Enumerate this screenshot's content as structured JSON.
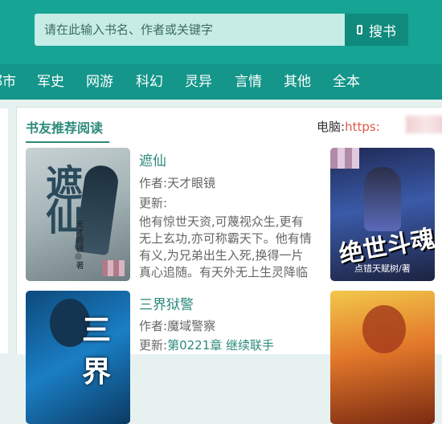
{
  "search": {
    "placeholder": "请在此输入书名、作者或关键字",
    "button_label": "搜书"
  },
  "nav": {
    "items": [
      {
        "label": "都市"
      },
      {
        "label": "军史"
      },
      {
        "label": "网游"
      },
      {
        "label": "科幻"
      },
      {
        "label": "灵异"
      },
      {
        "label": "言情"
      },
      {
        "label": "其他"
      },
      {
        "label": "全本"
      }
    ]
  },
  "section": {
    "title": "书友推荐阅读",
    "pc_label": "电脑:",
    "pc_url": "https:"
  },
  "books": [
    {
      "title": "遮仙",
      "author_label": "作者:",
      "author": "天才眼镜",
      "update_label": "更新:",
      "update": "",
      "description": "他有惊世天资,可蔑视众生,更有无上玄功,亦可称霸天下。他有情有义,为兄弟出生入死,换得一片真心追随。有天外无上生灵降临大",
      "cover_text": "遮仙",
      "cover_author": "天才眼镜◎著"
    },
    {
      "title": "三界狱警",
      "author_label": "作者:",
      "author": "魔域警察",
      "update_label": "更新:",
      "update": "第0221章 继续联手",
      "cover_text": "三界"
    }
  ],
  "side_covers": [
    {
      "cover_text": "绝世斗魂",
      "cover_author": "点错天赋树/著"
    },
    {
      "cover_text": ""
    }
  ]
}
